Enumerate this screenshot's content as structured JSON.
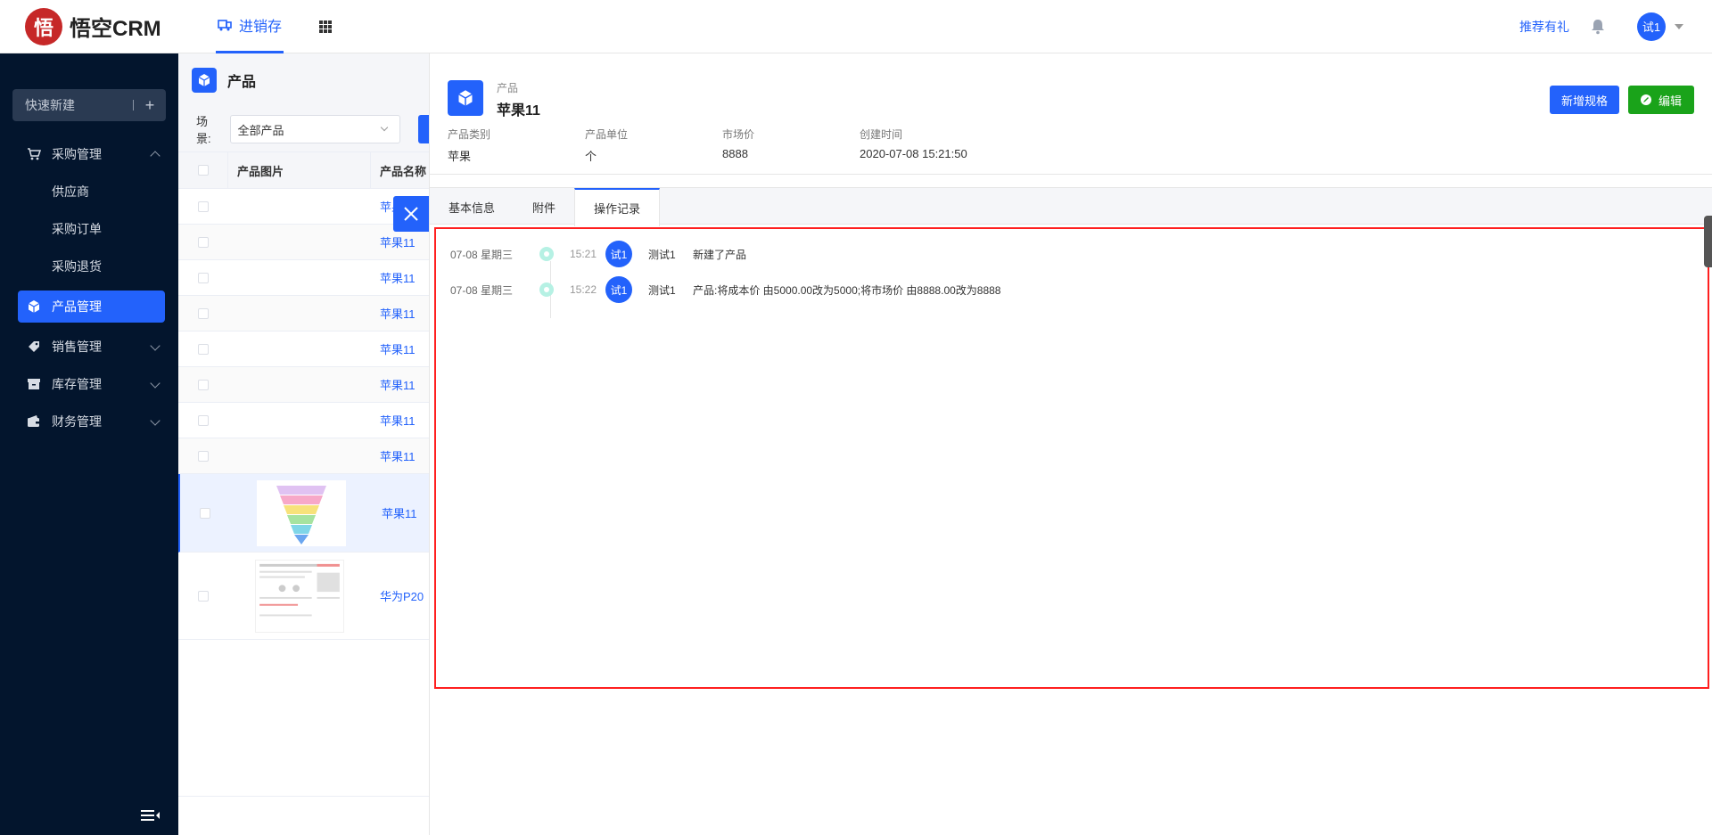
{
  "topbar": {
    "logo_text": "悟空CRM",
    "logo_badge": "悟",
    "nav_tab": "进销存",
    "recommend": "推荐有礼",
    "user_avatar": "试1"
  },
  "sidebar": {
    "quick_new": "快速新建",
    "quick_new_plus": "+",
    "menu": {
      "purchase": "采购管理",
      "supplier": "供应商",
      "purchase_order": "采购订单",
      "purchase_return": "采购退货",
      "product": "产品管理",
      "sales": "销售管理",
      "inventory": "库存管理",
      "finance": "财务管理"
    }
  },
  "list": {
    "title": "产品",
    "scene_label": "场景:",
    "scene_value": "全部产品",
    "col_image": "产品图片",
    "col_name": "产品名称",
    "rows": [
      "苹果",
      "苹果11",
      "苹果11",
      "苹果11",
      "苹果11",
      "苹果11",
      "苹果11",
      "苹果11",
      "苹果11",
      "华为P20"
    ]
  },
  "detail": {
    "subtitle": "产品",
    "title": "苹果11",
    "btn_spec": "新增规格",
    "btn_edit": "编辑",
    "fields": [
      {
        "label": "产品类别",
        "value": "苹果"
      },
      {
        "label": "产品单位",
        "value": "个"
      },
      {
        "label": "市场价",
        "value": "8888"
      },
      {
        "label": "创建时间",
        "value": "2020-07-08 15:21:50"
      }
    ],
    "tabs": [
      "基本信息",
      "附件",
      "操作记录"
    ],
    "logs": [
      {
        "date": "07-08 星期三",
        "time": "15:21",
        "avatar": "试1",
        "user": "测试1",
        "message": "新建了产品"
      },
      {
        "date": "07-08 星期三",
        "time": "15:22",
        "avatar": "试1",
        "user": "测试1",
        "message": "产品:将成本价 由5000.00改为5000;将市场价 由8888.00改为8888"
      }
    ]
  },
  "colors": {
    "primary": "#2362fb",
    "sidebar": "#03152d",
    "edit": "#1aa31a",
    "highlight": "#ff1f1f"
  }
}
